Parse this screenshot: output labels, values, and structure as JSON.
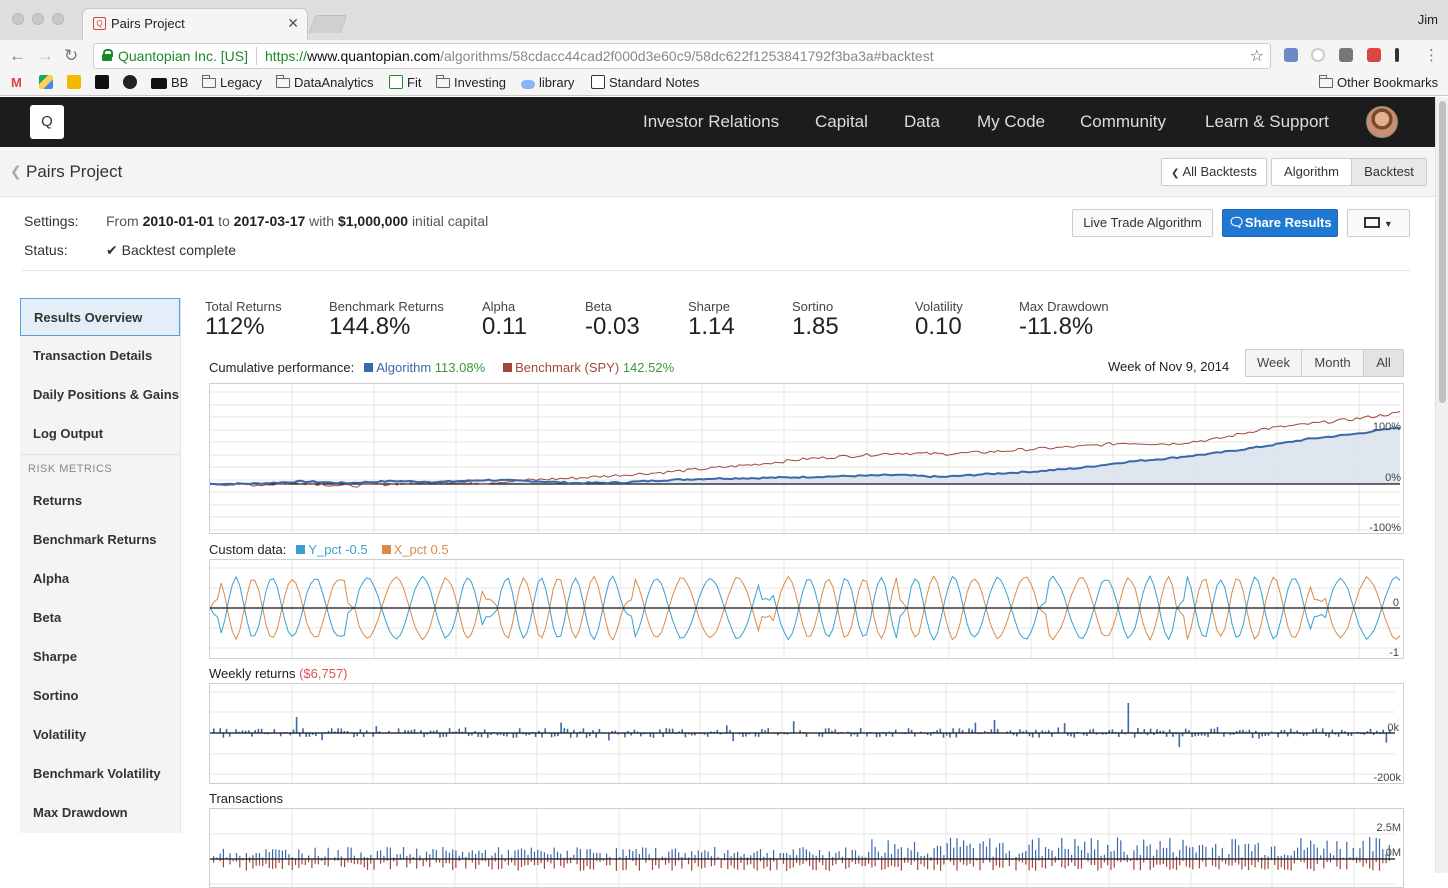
{
  "browser": {
    "tab_title": "Pairs Project",
    "user": "Jim",
    "org": "Quantopian Inc. [US]",
    "url_scheme": "https://",
    "url_host": "www.quantopian.com",
    "url_path": "/algorithms/58cdacc44cad2f000d3e60c9/58dc622f1253841792f3ba3a#backtest",
    "bookmarks": [
      "BB",
      "Legacy",
      "DataAnalytics",
      "Fit",
      "Investing",
      "library",
      "Standard Notes"
    ],
    "other_bookmarks": "Other Bookmarks"
  },
  "header": {
    "logo": "Q",
    "nav": [
      "Investor Relations",
      "Capital",
      "Data",
      "My Code",
      "Community",
      "Learn & Support"
    ]
  },
  "page": {
    "title": "Pairs Project",
    "buttons": {
      "all_backtests": "All Backtests",
      "algorithm": "Algorithm",
      "backtest": "Backtest"
    }
  },
  "settings": {
    "settings_label": "Settings:",
    "status_label": "Status:",
    "from_word": "From",
    "start": "2010-01-01",
    "to_word": "to",
    "end": "2017-03-17",
    "with_word": "with",
    "capital": "$1,000,000",
    "capital_suffix": "initial capital",
    "status": "Backtest complete",
    "live_trade": "Live Trade Algorithm",
    "share": "Share Results"
  },
  "sidebar": {
    "items": [
      "Results Overview",
      "Transaction Details",
      "Daily Positions & Gains",
      "Log Output"
    ],
    "risk_heading": "RISK METRICS",
    "risk_items": [
      "Returns",
      "Benchmark Returns",
      "Alpha",
      "Beta",
      "Sharpe",
      "Sortino",
      "Volatility",
      "Benchmark Volatility",
      "Max Drawdown"
    ]
  },
  "metrics": [
    {
      "label": "Total Returns",
      "value": "112%"
    },
    {
      "label": "Benchmark Returns",
      "value": "144.8%"
    },
    {
      "label": "Alpha",
      "value": "0.11"
    },
    {
      "label": "Beta",
      "value": "-0.03"
    },
    {
      "label": "Sharpe",
      "value": "1.14"
    },
    {
      "label": "Sortino",
      "value": "1.85"
    },
    {
      "label": "Volatility",
      "value": "0.10"
    },
    {
      "label": "Max Drawdown",
      "value": "-11.8%"
    }
  ],
  "cumulative": {
    "label": "Cumulative performance:",
    "algo_name": "Algorithm",
    "algo_value": "113.08%",
    "bench_name": "Benchmark (SPY)",
    "bench_value": "142.52%",
    "week_label": "Week of Nov 9, 2014",
    "ranges": [
      "Week",
      "Month",
      "All"
    ],
    "active_range": "All",
    "yticks": [
      "100%",
      "0%",
      "-100%"
    ]
  },
  "custom": {
    "label": "Custom data:",
    "y_name": "Y_pct",
    "y_value": "-0.5",
    "x_name": "X_pct",
    "x_value": "0.5",
    "yticks": [
      "0",
      "-1"
    ]
  },
  "weekly": {
    "label": "Weekly returns",
    "value": "($6,757)",
    "yticks": [
      "0k",
      "-200k"
    ]
  },
  "transactions": {
    "label": "Transactions",
    "yticks": [
      "2.5M",
      "0M"
    ]
  },
  "colors": {
    "algo": "#3b68a8",
    "bench": "#a2463e",
    "y_pct": "#3aa0d0",
    "x_pct": "#d98c4a",
    "share_button": "#1f78d1",
    "weekly_value": "#d9534f"
  },
  "chart_data": [
    {
      "type": "area",
      "title": "Cumulative performance:",
      "x_range": [
        "2010-01-01",
        "2017-03-17"
      ],
      "ylim": [
        -1.0,
        1.0
      ],
      "series": [
        {
          "name": "Algorithm",
          "values_pct_start_to_end": [
            0,
            1,
            5,
            2,
            6,
            4,
            8,
            6,
            2,
            3,
            8,
            11,
            12,
            14,
            16,
            18,
            14,
            20,
            25,
            32,
            44,
            52,
            62,
            75,
            90,
            100,
            113.08
          ]
        },
        {
          "name": "Benchmark (SPY)",
          "values_pct_start_to_end": [
            0,
            -2,
            2,
            -4,
            0,
            5,
            2,
            8,
            12,
            18,
            24,
            32,
            40,
            50,
            56,
            62,
            60,
            64,
            70,
            75,
            82,
            80,
            90,
            110,
            120,
            130,
            142.52
          ]
        }
      ]
    },
    {
      "type": "line",
      "title": "Custom data:",
      "ylim": [
        -1,
        0.5
      ],
      "series": [
        {
          "name": "Y_pct",
          "last_value": -0.5
        },
        {
          "name": "X_pct",
          "last_value": 0.5
        }
      ]
    },
    {
      "type": "bar",
      "title": "Weekly returns",
      "ylim": [
        -200000,
        100000
      ],
      "last_value": -6757
    },
    {
      "type": "bar",
      "title": "Transactions",
      "ytick_labels": [
        "2.5M",
        "0M"
      ]
    }
  ]
}
